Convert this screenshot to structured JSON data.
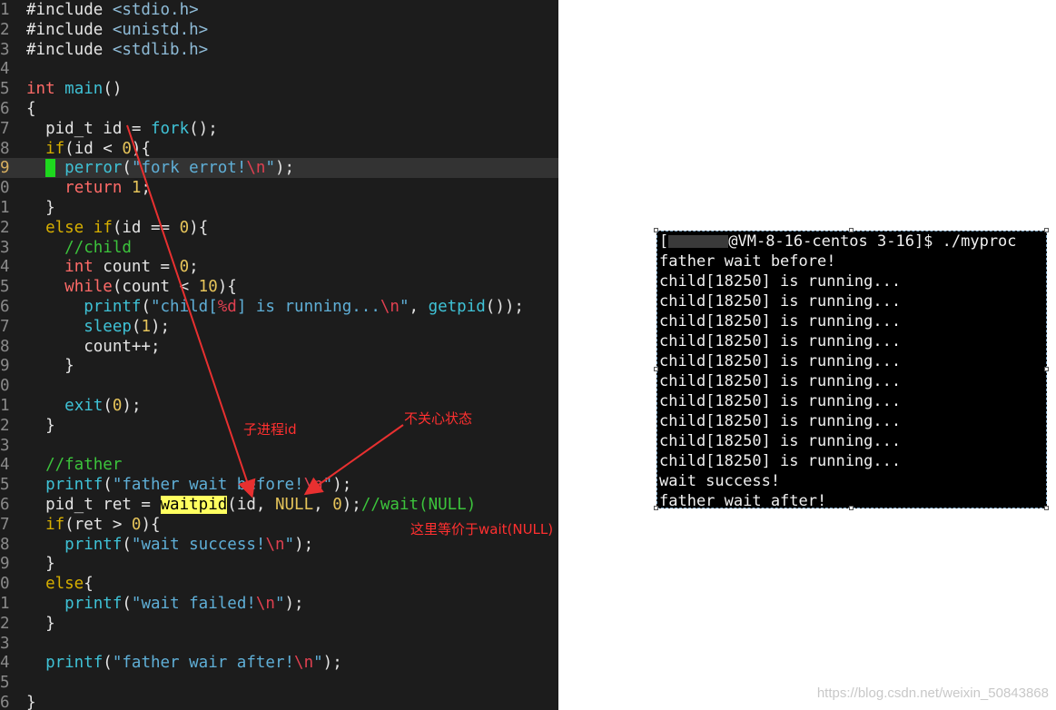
{
  "editor": {
    "lines": [
      {
        "n": "1",
        "tokens": [
          [
            "pre",
            "#include "
          ],
          [
            "inc",
            "<stdio.h>"
          ]
        ]
      },
      {
        "n": "2",
        "tokens": [
          [
            "pre",
            "#include "
          ],
          [
            "inc",
            "<unistd.h>"
          ]
        ]
      },
      {
        "n": "3",
        "tokens": [
          [
            "pre",
            "#include "
          ],
          [
            "inc",
            "<stdlib.h>"
          ]
        ]
      },
      {
        "n": "4",
        "tokens": []
      },
      {
        "n": "5",
        "tokens": [
          [
            "type",
            "int"
          ],
          [
            "plain",
            " "
          ],
          [
            "func",
            "main"
          ],
          [
            "plain",
            "()"
          ]
        ]
      },
      {
        "n": "6",
        "tokens": [
          [
            "plain",
            "{"
          ]
        ]
      },
      {
        "n": "7",
        "tokens": [
          [
            "plain",
            "  pid_t id = "
          ],
          [
            "func",
            "fork"
          ],
          [
            "plain",
            "();"
          ]
        ]
      },
      {
        "n": "8",
        "tokens": [
          [
            "plain",
            "  "
          ],
          [
            "kw",
            "if"
          ],
          [
            "plain",
            "(id < "
          ],
          [
            "num",
            "0"
          ],
          [
            "plain",
            "){"
          ]
        ]
      },
      {
        "n": "9",
        "current": true,
        "tokens": [
          [
            "plain",
            "  "
          ],
          [
            "cursor",
            " "
          ],
          [
            "plain",
            " "
          ],
          [
            "func",
            "perror"
          ],
          [
            "plain",
            "("
          ],
          [
            "str",
            "\"fork errot!"
          ],
          [
            "esc",
            "\\n"
          ],
          [
            "str",
            "\""
          ],
          [
            "plain",
            ");"
          ]
        ]
      },
      {
        "n": "0",
        "tokens": [
          [
            "plain",
            "    "
          ],
          [
            "type",
            "return"
          ],
          [
            "plain",
            " "
          ],
          [
            "num",
            "1"
          ],
          [
            "plain",
            ";"
          ]
        ]
      },
      {
        "n": "1",
        "tokens": [
          [
            "plain",
            "  }"
          ]
        ]
      },
      {
        "n": "2",
        "tokens": [
          [
            "plain",
            "  "
          ],
          [
            "kw",
            "else"
          ],
          [
            "plain",
            " "
          ],
          [
            "kw",
            "if"
          ],
          [
            "plain",
            "(id == "
          ],
          [
            "num",
            "0"
          ],
          [
            "plain",
            "){"
          ]
        ]
      },
      {
        "n": "3",
        "tokens": [
          [
            "plain",
            "    "
          ],
          [
            "cmt",
            "//child"
          ]
        ]
      },
      {
        "n": "4",
        "tokens": [
          [
            "plain",
            "    "
          ],
          [
            "type",
            "int"
          ],
          [
            "plain",
            " count = "
          ],
          [
            "num",
            "0"
          ],
          [
            "plain",
            ";"
          ]
        ]
      },
      {
        "n": "5",
        "tokens": [
          [
            "plain",
            "    "
          ],
          [
            "type",
            "while"
          ],
          [
            "plain",
            "(count < "
          ],
          [
            "num",
            "10"
          ],
          [
            "plain",
            "){"
          ]
        ]
      },
      {
        "n": "6",
        "tokens": [
          [
            "plain",
            "      "
          ],
          [
            "func",
            "printf"
          ],
          [
            "plain",
            "("
          ],
          [
            "str",
            "\"child["
          ],
          [
            "esc",
            "%d"
          ],
          [
            "str",
            "] is running..."
          ],
          [
            "esc",
            "\\n"
          ],
          [
            "str",
            "\""
          ],
          [
            "plain",
            ", "
          ],
          [
            "func",
            "getpid"
          ],
          [
            "plain",
            "());"
          ]
        ]
      },
      {
        "n": "7",
        "tokens": [
          [
            "plain",
            "      "
          ],
          [
            "func",
            "sleep"
          ],
          [
            "plain",
            "("
          ],
          [
            "num",
            "1"
          ],
          [
            "plain",
            ");"
          ]
        ]
      },
      {
        "n": "8",
        "tokens": [
          [
            "plain",
            "      count++;"
          ]
        ]
      },
      {
        "n": "9",
        "tokens": [
          [
            "plain",
            "    }"
          ]
        ]
      },
      {
        "n": "0",
        "tokens": []
      },
      {
        "n": "1",
        "tokens": [
          [
            "plain",
            "    "
          ],
          [
            "func",
            "exit"
          ],
          [
            "plain",
            "("
          ],
          [
            "num",
            "0"
          ],
          [
            "plain",
            ");"
          ]
        ]
      },
      {
        "n": "2",
        "tokens": [
          [
            "plain",
            "  }"
          ]
        ]
      },
      {
        "n": "3",
        "tokens": []
      },
      {
        "n": "4",
        "tokens": [
          [
            "plain",
            "  "
          ],
          [
            "cmt",
            "//father"
          ]
        ]
      },
      {
        "n": "5",
        "tokens": [
          [
            "plain",
            "  "
          ],
          [
            "func",
            "printf"
          ],
          [
            "plain",
            "("
          ],
          [
            "str",
            "\"father wait before!"
          ],
          [
            "esc",
            "\\n"
          ],
          [
            "str",
            "\""
          ],
          [
            "plain",
            ");"
          ]
        ]
      },
      {
        "n": "6",
        "tokens": [
          [
            "plain",
            "  pid_t ret = "
          ],
          [
            "search",
            "waitpid"
          ],
          [
            "plain",
            "(id, "
          ],
          [
            "num",
            "NULL"
          ],
          [
            "plain",
            ", "
          ],
          [
            "num",
            "0"
          ],
          [
            "plain",
            ");"
          ],
          [
            "cmt",
            "//wait(NULL)"
          ]
        ]
      },
      {
        "n": "7",
        "tokens": [
          [
            "plain",
            "  "
          ],
          [
            "kw",
            "if"
          ],
          [
            "plain",
            "(ret > "
          ],
          [
            "num",
            "0"
          ],
          [
            "plain",
            "){"
          ]
        ]
      },
      {
        "n": "8",
        "tokens": [
          [
            "plain",
            "    "
          ],
          [
            "func",
            "printf"
          ],
          [
            "plain",
            "("
          ],
          [
            "str",
            "\"wait success!"
          ],
          [
            "esc",
            "\\n"
          ],
          [
            "str",
            "\""
          ],
          [
            "plain",
            ");"
          ]
        ]
      },
      {
        "n": "9",
        "tokens": [
          [
            "plain",
            "  }"
          ]
        ]
      },
      {
        "n": "0",
        "tokens": [
          [
            "plain",
            "  "
          ],
          [
            "kw",
            "else"
          ],
          [
            "plain",
            "{"
          ]
        ]
      },
      {
        "n": "1",
        "tokens": [
          [
            "plain",
            "    "
          ],
          [
            "func",
            "printf"
          ],
          [
            "plain",
            "("
          ],
          [
            "str",
            "\"wait failed!"
          ],
          [
            "esc",
            "\\n"
          ],
          [
            "str",
            "\""
          ],
          [
            "plain",
            ");"
          ]
        ]
      },
      {
        "n": "2",
        "tokens": [
          [
            "plain",
            "  }"
          ]
        ]
      },
      {
        "n": "3",
        "tokens": []
      },
      {
        "n": "4",
        "tokens": [
          [
            "plain",
            "  "
          ],
          [
            "func",
            "printf"
          ],
          [
            "plain",
            "("
          ],
          [
            "str",
            "\"father wair after!"
          ],
          [
            "esc",
            "\\n"
          ],
          [
            "str",
            "\""
          ],
          [
            "plain",
            ");"
          ]
        ]
      },
      {
        "n": "5",
        "tokens": []
      },
      {
        "n": "6",
        "tokens": [
          [
            "plain",
            "}"
          ]
        ]
      }
    ]
  },
  "annotations": {
    "child_pid_label": "子进程id",
    "ignore_status_label": "不关心状态",
    "equivalent_label": "这里等价于wait(NULL)",
    "arrow_color": "#e83030"
  },
  "terminal": {
    "prompt_prefix": "[",
    "prompt_suffix": "@VM-8-16-centos 3-16]$ ./myproc",
    "output": [
      "father wait before!",
      "child[18250] is running...",
      "child[18250] is running...",
      "child[18250] is running...",
      "child[18250] is running...",
      "child[18250] is running...",
      "child[18250] is running...",
      "child[18250] is running...",
      "child[18250] is running...",
      "child[18250] is running...",
      "child[18250] is running...",
      "wait success!",
      "father wait after!"
    ]
  },
  "watermark": "https://blog.csdn.net/weixin_50843868"
}
